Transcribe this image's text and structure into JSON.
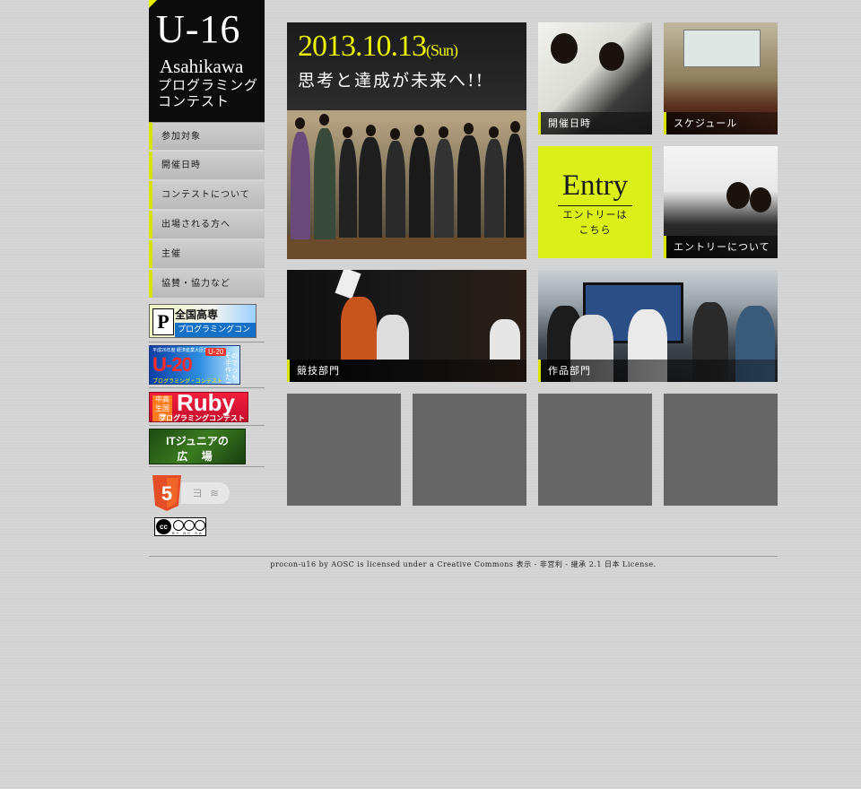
{
  "logo": {
    "big": "U-16",
    "line1": "Asahikawa",
    "line2": "プログラミング",
    "line3": "コンテスト"
  },
  "nav": [
    {
      "label": "参加対象"
    },
    {
      "label": "開催日時"
    },
    {
      "label": "コンテストについて"
    },
    {
      "label": "出場される方へ"
    },
    {
      "label": "主催"
    },
    {
      "label": "協賛・協力など"
    }
  ],
  "banners": {
    "kosen": {
      "mark": "P",
      "title": "全国高専",
      "sub": "プログラミングコンテスト"
    },
    "u20": {
      "top": "平成26年度 経済産業大臣賞",
      "title": "U-20",
      "sub": "プログラミング・コンテスト",
      "badge": "U-20",
      "side": "その手で作ったもの"
    },
    "ruby": {
      "tag": "中高生国際",
      "title": "Ruby",
      "sub": "プログラミングコンテスト"
    },
    "itjunior": {
      "line1": "ITジュニアの",
      "line2": "広 場"
    }
  },
  "html5": {
    "number": "5",
    "icon2": "ヨ",
    "icon3": "≋"
  },
  "cc_badge": {
    "cc": "cc",
    "labels": "BY NC SA"
  },
  "hero": {
    "date": "2013.10.13",
    "day": "(Sun)",
    "slogan": "思考と達成が未来へ!!"
  },
  "tiles": {
    "date": "開催日時",
    "schedule": "スケジュール",
    "entry_big": "Entry",
    "entry_sub1": "エントリーは",
    "entry_sub2": "こちら",
    "about_entry": "エントリーについて",
    "competition": "競技部門",
    "works": "作品部門"
  },
  "footer": {
    "text": "procon-u16 by AOSC is licensed under a Creative Commons 表示 - 非営利 - 継承 2.1 日本 License."
  },
  "colors": {
    "accent": "#d8e300",
    "entry_bg": "#dcef19",
    "placeholder": "#666666",
    "page_bg": "#d4d4d4"
  }
}
